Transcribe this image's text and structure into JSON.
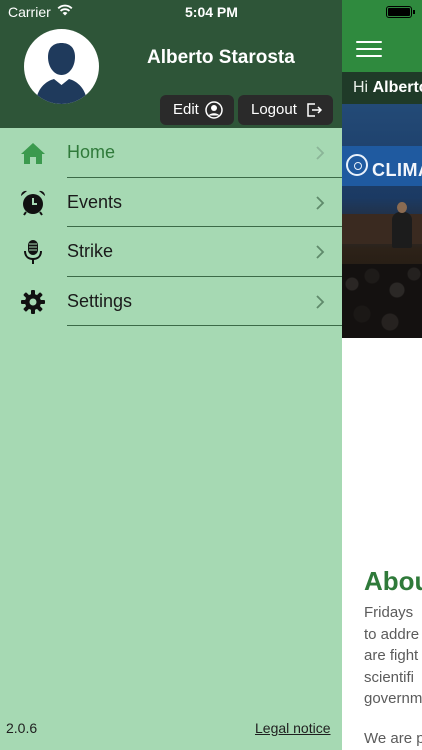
{
  "status_bar": {
    "carrier": "Carrier",
    "time": "5:04 PM"
  },
  "user": {
    "name": "Alberto Starosta"
  },
  "header": {
    "edit_label": "Edit",
    "logout_label": "Logout"
  },
  "menu": [
    {
      "label": "Home",
      "icon": "home-icon",
      "active": true
    },
    {
      "label": "Events",
      "icon": "alarm-clock-icon",
      "active": false
    },
    {
      "label": "Strike",
      "icon": "microphone-icon",
      "active": false
    },
    {
      "label": "Settings",
      "icon": "gear-icon",
      "active": false
    }
  ],
  "footer": {
    "version": "2.0.6",
    "legal_label": "Legal notice"
  },
  "main": {
    "greeting_prefix": "Hi ",
    "greeting_name": "Alberto",
    "photo_banner_text": "CLIMA",
    "about_title": "Abou",
    "about_lines": [
      "Fridays",
      "to addre",
      "are fight",
      "scientifi",
      "governm"
    ],
    "about_next": "We are p"
  },
  "colors": {
    "drawer_bg": "#a6d9b3",
    "header_bg": "#2e5538",
    "accent_green": "#2f7a3a",
    "app_bar_green": "#2f8a3e"
  }
}
